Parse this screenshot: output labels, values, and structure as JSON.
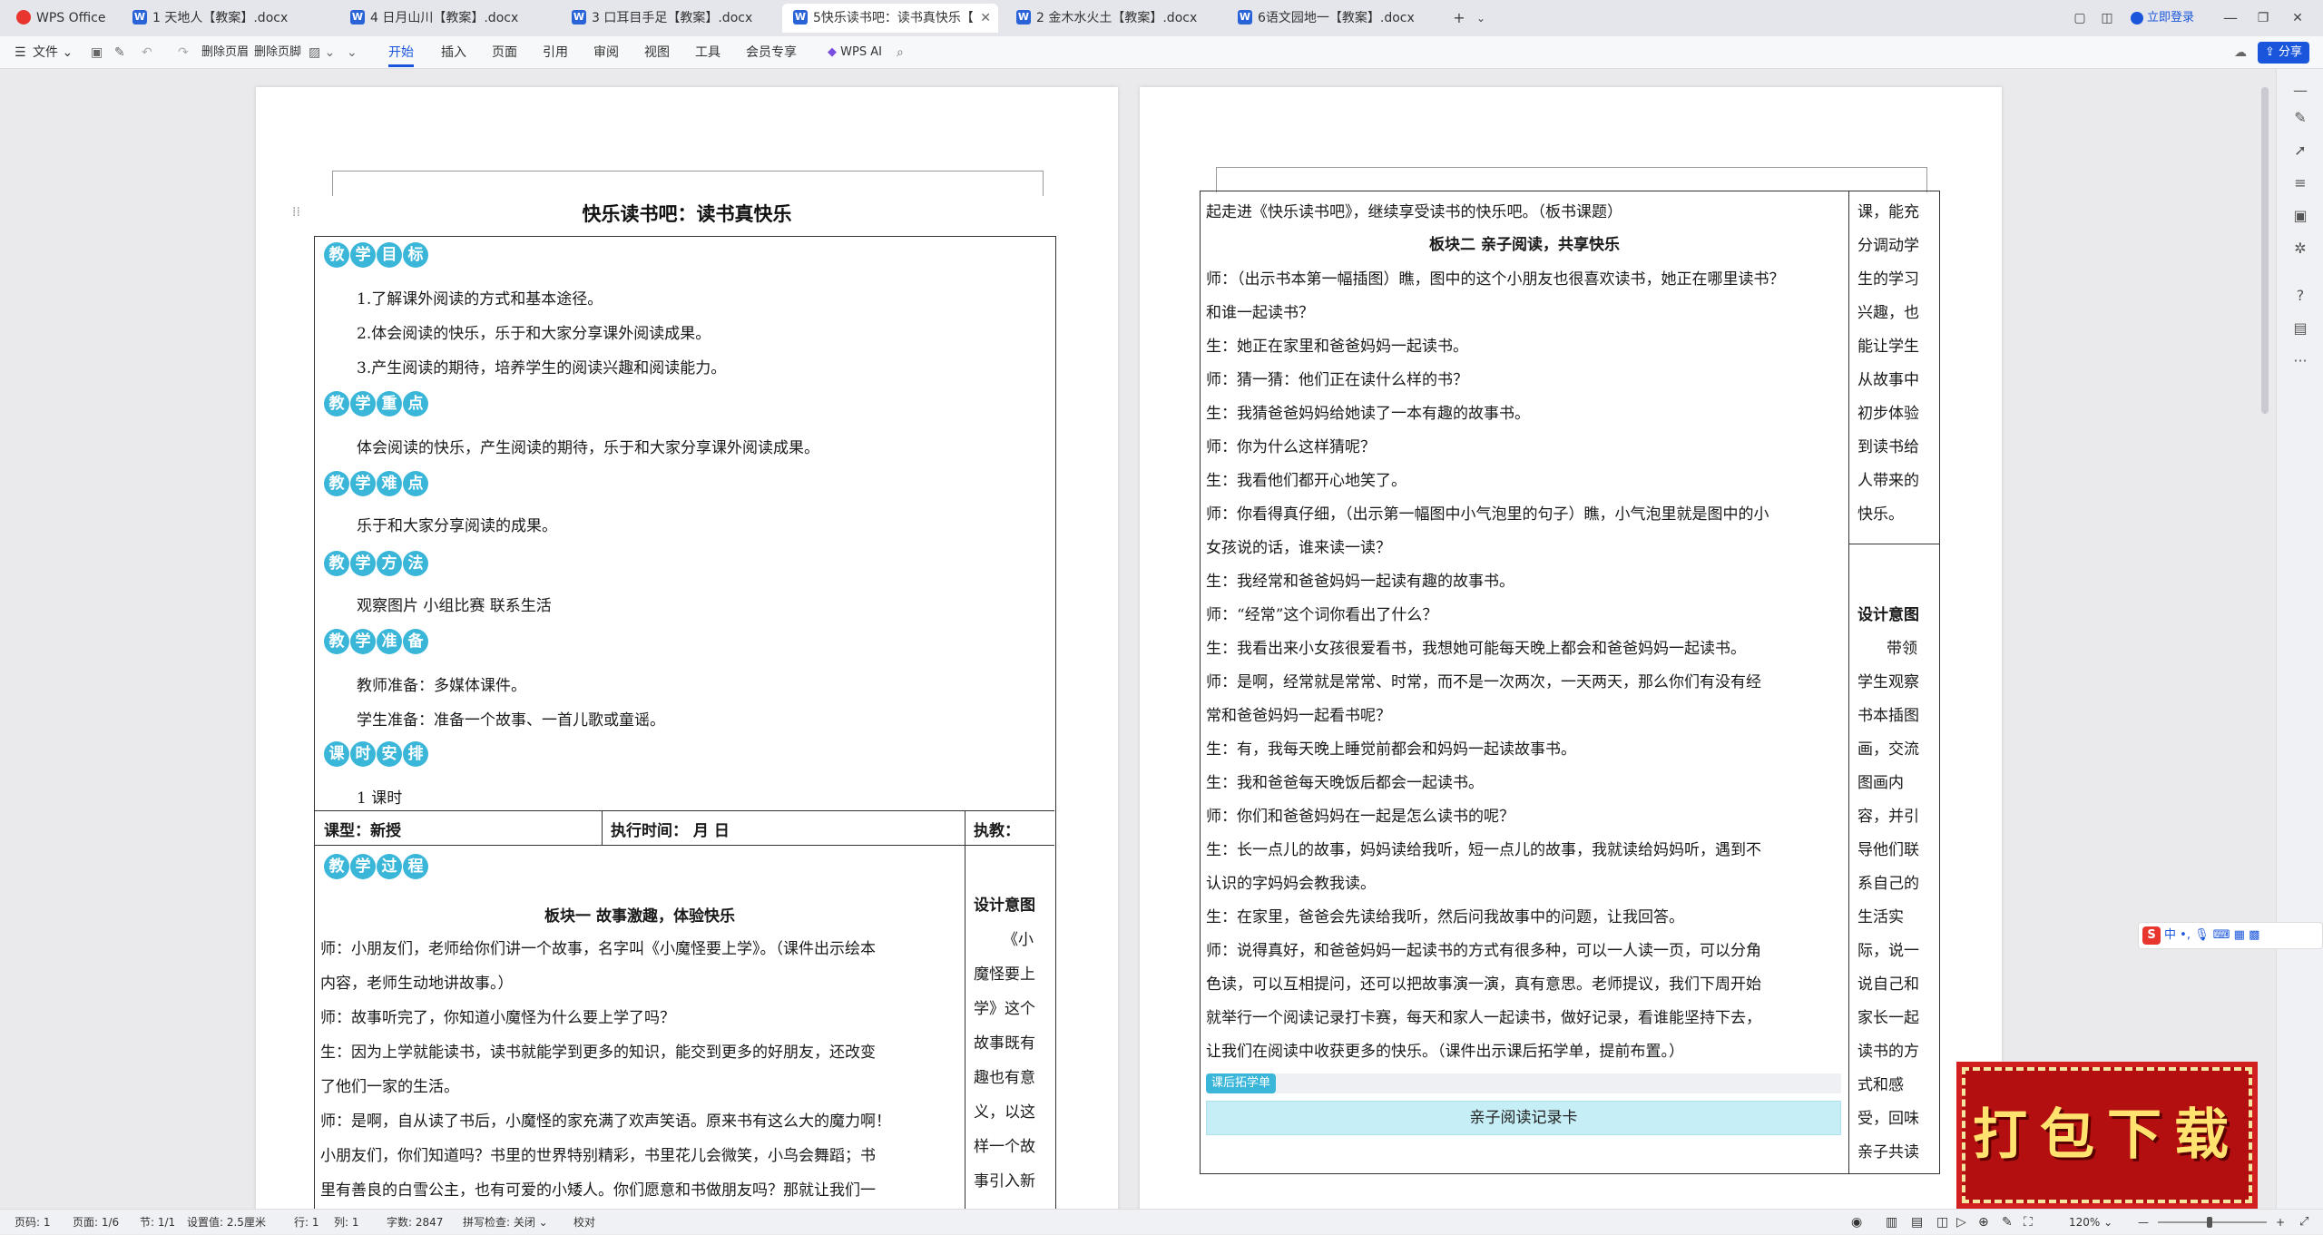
{
  "app": {
    "name": "WPS Office"
  },
  "tabs": [
    {
      "label": "1 天地人【教案】.docx"
    },
    {
      "label": "4 日月山川【教案】.docx"
    },
    {
      "label": "3 口耳目手足【教案】.docx"
    },
    {
      "label": "5快乐读书吧：读书真快乐【"
    },
    {
      "label": "2 金木水火土【教案】.docx"
    },
    {
      "label": "6语文园地一【教案】.docx"
    }
  ],
  "titlebar": {
    "login": "立即登录"
  },
  "toolbar": {
    "file": "文件",
    "delete_header": "删除页眉",
    "delete_footer": "删除页脚",
    "share": "分享",
    "wps_ai": "WPS AI"
  },
  "ribbon_tabs": [
    "开始",
    "插入",
    "页面",
    "引用",
    "审阅",
    "视图",
    "工具",
    "会员专享"
  ],
  "doc": {
    "title": "快乐读书吧：读书真快乐",
    "sections": {
      "goal": "教学目标",
      "key": "教学重点",
      "difficult": "教学难点",
      "method": "教学方法",
      "prep": "教学准备",
      "schedule": "课时安排",
      "process": "教学过程"
    },
    "goals": [
      "1.了解课外阅读的方式和基本途径。",
      "2.体会阅读的快乐，乐于和大家分享课外阅读成果。",
      "3.产生阅读的期待，培养学生的阅读兴趣和阅读能力。"
    ],
    "key_text": "体会阅读的快乐，产生阅读的期待，乐于和大家分享课外阅读成果。",
    "difficult_text": "乐于和大家分享阅读的成果。",
    "method_text": "观察图片    小组比赛    联系生活",
    "prep": [
      "教师准备：多媒体课件。",
      "学生准备：准备一个故事、一首儿歌或童谣。"
    ],
    "schedule_text": "1 课时",
    "row": {
      "type": "课型：新授",
      "time": "执行时间：         月       日",
      "teacher": "执教："
    },
    "block1_title": "板块一    故事激趣，体验快乐",
    "page1_lines": [
      "师：小朋友们，老师给你们讲一个故事，名字叫《小魔怪要上学》。（课件出示绘本",
      "内容，老师生动地讲故事。）",
      "师：故事听完了，你知道小魔怪为什么要上学了吗？",
      "生：因为上学就能读书，读书就能学到更多的知识，能交到更多的好朋友，还改变",
      "了他们一家的生活。",
      "师：是啊，自从读了书后，小魔怪的家充满了欢声笑语。原来书有这么大的魔力啊！",
      "小朋友们，你们知道吗？书里的世界特别精彩，书里花儿会微笑，小鸟会舞蹈；书",
      "里有善良的白雪公主，也有可爱的小矮人。你们愿意和书做朋友吗？那就让我们一"
    ],
    "design_label": "设计意图",
    "page1_side": [
      "《小",
      "魔怪要上",
      "学》这个",
      "故事既有",
      "趣也有意",
      "义，以这",
      "样一个故",
      "事引入新"
    ],
    "page2_lines": [
      "起走进《快乐读书吧》，继续享受读书的快乐吧。（板书课题）",
      "师：（出示书本第一幅插图）瞧，图中的这个小朋友也很喜欢读书，她正在哪里读书？",
      "和谁一起读书？",
      "生：她正在家里和爸爸妈妈一起读书。",
      "师：猜一猜：他们正在读什么样的书？",
      "生：我猜爸爸妈妈给她读了一本有趣的故事书。",
      "师：你为什么这样猜呢？",
      "生：我看他们都开心地笑了。",
      "师：你看得真仔细，（出示第一幅图中小气泡里的句子）瞧，小气泡里就是图中的小",
      "女孩说的话，谁来读一读？",
      "生：我经常和爸爸妈妈一起读有趣的故事书。",
      "师：“经常”这个词你看出了什么？",
      "生：我看出来小女孩很爱看书，我想她可能每天晚上都会和爸爸妈妈一起读书。",
      "师：是啊，经常就是常常、时常，而不是一次两次，一天两天，那么你们有没有经",
      "常和爸爸妈妈一起看书呢？",
      "生：有，我每天晚上睡觉前都会和妈妈一起读故事书。",
      "生：我和爸爸每天晚饭后都会一起读书。",
      "师：你们和爸爸妈妈在一起是怎么读书的呢？",
      "生：长一点儿的故事，妈妈读给我听，短一点儿的故事，我就读给妈妈听，遇到不",
      "认识的字妈妈会教我读。",
      "生：在家里，爸爸会先读给我听，然后问我故事中的问题，让我回答。",
      "师：说得真好，和爸爸妈妈一起读书的方式有很多种，可以一人读一页，可以分角",
      "色读，可以互相提问，还可以把故事演一演，真有意思。老师提议，我们下周开始",
      "就举行一个阅读记录打卡赛，每天和家人一起读书，做好记录，看谁能坚持下去，",
      "让我们在阅读中收获更多的快乐。（课件出示课后拓学单，提前布置。）"
    ],
    "block2_title": "板块二    亲子阅读，共享快乐",
    "page2_side": [
      "课，能充",
      "分调动学",
      "生的学习",
      "兴趣，也",
      "能让学生",
      "从故事中",
      "初步体验",
      "到读书给",
      "人带来的",
      "快乐。"
    ],
    "page2_side_design": "设计意图",
    "page2_side2": [
      "带领",
      "学生观察",
      "书本插图",
      "画，交流",
      "图画内",
      "容，并引",
      "导他们联",
      "系自己的",
      "生活实",
      "际，说一",
      "说自己和",
      "家长一起",
      "读书的方",
      "式和感",
      "受，回味",
      "亲子共读"
    ],
    "extend_badge": "课后拓学单",
    "card_title": "亲子阅读记录卡"
  },
  "status": {
    "page_no": "页码: 1",
    "pages": "页面: 1/6",
    "section": "节: 1/1",
    "setting": "设置值: 2.5厘米",
    "row": "行: 1",
    "col": "列: 1",
    "words": "字数: 2847",
    "spell": "拼写检查: 关闭",
    "proof": "校对",
    "zoom": "120%"
  },
  "ime": {
    "label": "中"
  },
  "ad": {
    "text": "打包下载"
  }
}
